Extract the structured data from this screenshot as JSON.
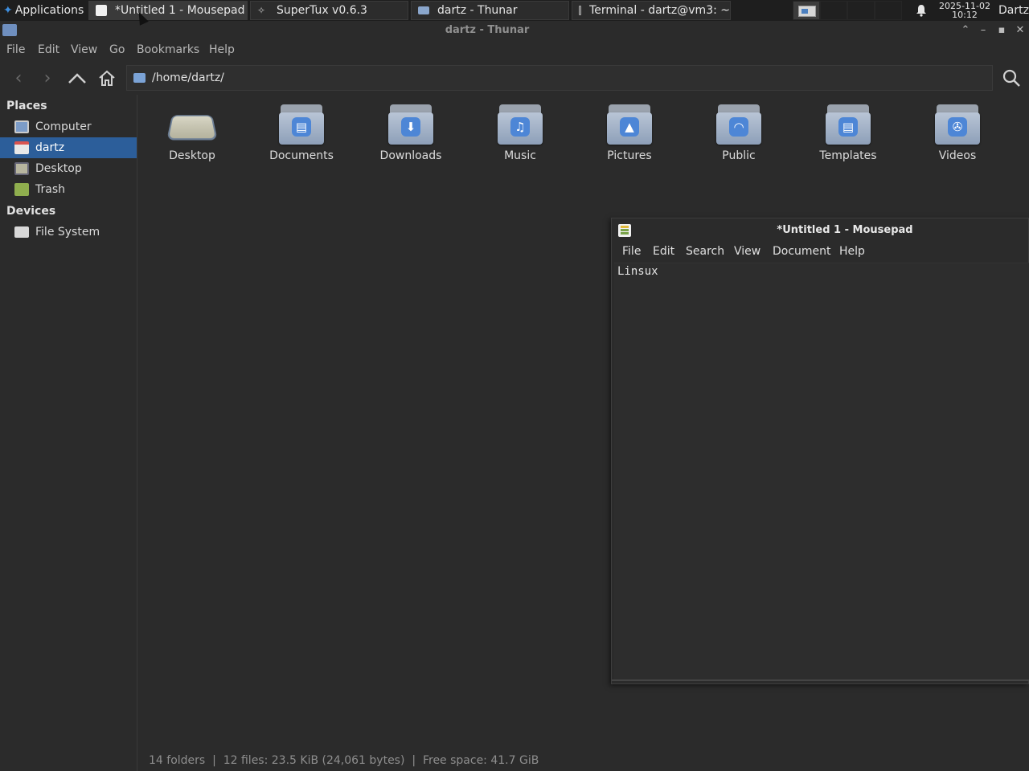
{
  "taskbar": {
    "applications_label": "Applications",
    "tasks": [
      {
        "title": "*Untitled 1 - Mousepad",
        "icon": "text-editor-icon"
      },
      {
        "title": "SuperTux v0.6.3",
        "icon": "game-icon"
      },
      {
        "title": "dartz - Thunar",
        "icon": "folder-icon"
      },
      {
        "title": "Terminal - dartz@vm3: ~",
        "icon": "terminal-icon"
      }
    ],
    "clock_date": "2025-11-02",
    "clock_time": "10:12",
    "user": "Dartz"
  },
  "thunar": {
    "window_title": "dartz - Thunar",
    "menu": [
      "File",
      "Edit",
      "View",
      "Go",
      "Bookmarks",
      "Help"
    ],
    "location": "/home/dartz/",
    "sidebar": {
      "places_heading": "Places",
      "places": [
        {
          "label": "Computer",
          "icon": "computer-icon"
        },
        {
          "label": "dartz",
          "icon": "home-icon",
          "selected": true
        },
        {
          "label": "Desktop",
          "icon": "desktop-icon"
        },
        {
          "label": "Trash",
          "icon": "trash-icon"
        }
      ],
      "devices_heading": "Devices",
      "devices": [
        {
          "label": "File System",
          "icon": "drive-icon"
        }
      ]
    },
    "files": [
      {
        "label": "Desktop",
        "emblem": "desktop"
      },
      {
        "label": "Documents",
        "emblem": "document"
      },
      {
        "label": "Downloads",
        "emblem": "download"
      },
      {
        "label": "Music",
        "emblem": "music"
      },
      {
        "label": "Pictures",
        "emblem": "picture"
      },
      {
        "label": "Public",
        "emblem": "share"
      },
      {
        "label": "Templates",
        "emblem": "template"
      },
      {
        "label": "Videos",
        "emblem": "video"
      }
    ],
    "status": "14 folders  |  12 files: 23.5 KiB (24,061 bytes)  |  Free space: 41.7 GiB"
  },
  "mousepad": {
    "window_title": "*Untitled 1 - Mousepad",
    "menu": [
      "File",
      "Edit",
      "Search",
      "View",
      "Document",
      "Help"
    ],
    "content": "Linsux"
  }
}
